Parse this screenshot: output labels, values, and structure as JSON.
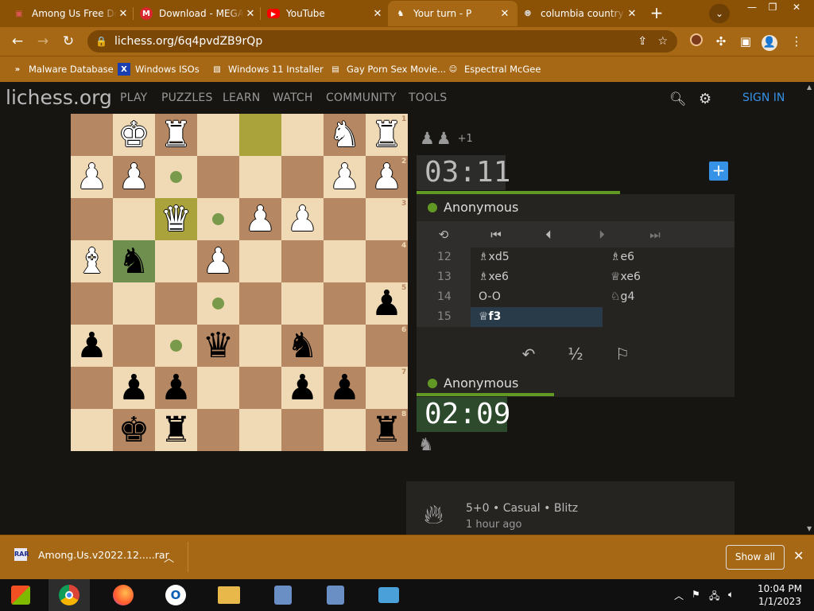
{
  "browser": {
    "tabs": [
      {
        "title": "Among Us Free Do",
        "icon": "app-icon",
        "active": false
      },
      {
        "title": "Download - MEGA",
        "icon": "mega-icon",
        "active": false
      },
      {
        "title": "YouTube",
        "icon": "youtube-icon",
        "active": false
      },
      {
        "title": "Your turn - P",
        "icon": "lichess-icon",
        "active": true
      },
      {
        "title": "columbia country",
        "icon": "globe-icon",
        "active": false
      }
    ],
    "new_tab": "+",
    "url": "lichess.org/6q4pvdZB9rQp",
    "bookmarks": [
      {
        "label": "Malware Database",
        "icon": "chevron-icon"
      },
      {
        "label": "Windows ISOs",
        "icon": "x-icon"
      },
      {
        "label": "Windows 11 Installer",
        "icon": "image-icon"
      },
      {
        "label": "Gay Porn Sex Movie...",
        "icon": "tv-icon"
      },
      {
        "label": "Espectral McGee",
        "icon": "avatar-icon"
      }
    ],
    "theme_color": "#a66815"
  },
  "site": {
    "logo_main": "lichess",
    "logo_tld": ".org",
    "nav": [
      "PLAY",
      "PUZZLES",
      "LEARN",
      "WATCH",
      "COMMUNITY",
      "TOOLS"
    ],
    "sign_in": "SIGN IN"
  },
  "board": {
    "orientation": "black",
    "files_bottom": [
      "h",
      "g",
      "f",
      "e",
      "d",
      "c",
      "b",
      "a"
    ],
    "ranks_right": [
      "1",
      "2",
      "3",
      "4",
      "5",
      "6",
      "7",
      "8"
    ],
    "pieces": [
      {
        "sq": "g1",
        "color": "w",
        "piece": "king"
      },
      {
        "sq": "f1",
        "color": "w",
        "piece": "rook"
      },
      {
        "sq": "b1",
        "color": "w",
        "piece": "knight"
      },
      {
        "sq": "a1",
        "color": "w",
        "piece": "rook"
      },
      {
        "sq": "h2",
        "color": "w",
        "piece": "pawn"
      },
      {
        "sq": "g2",
        "color": "w",
        "piece": "pawn"
      },
      {
        "sq": "b2",
        "color": "w",
        "piece": "pawn"
      },
      {
        "sq": "a2",
        "color": "w",
        "piece": "pawn"
      },
      {
        "sq": "f3",
        "color": "w",
        "piece": "queen"
      },
      {
        "sq": "d3",
        "color": "w",
        "piece": "pawn"
      },
      {
        "sq": "c3",
        "color": "w",
        "piece": "pawn"
      },
      {
        "sq": "h4",
        "color": "w",
        "piece": "bishop"
      },
      {
        "sq": "e4",
        "color": "w",
        "piece": "pawn"
      },
      {
        "sq": "g4",
        "color": "b",
        "piece": "knight"
      },
      {
        "sq": "a5",
        "color": "b",
        "piece": "pawn"
      },
      {
        "sq": "h6",
        "color": "b",
        "piece": "pawn"
      },
      {
        "sq": "e6",
        "color": "b",
        "piece": "queen"
      },
      {
        "sq": "c6",
        "color": "b",
        "piece": "knight"
      },
      {
        "sq": "g7",
        "color": "b",
        "piece": "pawn"
      },
      {
        "sq": "f7",
        "color": "b",
        "piece": "pawn"
      },
      {
        "sq": "c7",
        "color": "b",
        "piece": "pawn"
      },
      {
        "sq": "b7",
        "color": "b",
        "piece": "pawn"
      },
      {
        "sq": "g8",
        "color": "b",
        "piece": "king"
      },
      {
        "sq": "f8",
        "color": "b",
        "piece": "rook"
      },
      {
        "sq": "a8",
        "color": "b",
        "piece": "rook"
      }
    ],
    "last_move": [
      "d1",
      "f3"
    ],
    "selected": "g4",
    "move_dots": [
      "f2",
      "e3",
      "e5",
      "f6"
    ]
  },
  "game": {
    "top_player": {
      "name": "Anonymous",
      "clock": "03:11",
      "material": [
        "pawn",
        "pawn"
      ],
      "material_plus": "+1"
    },
    "bottom_player": {
      "name": "Anonymous",
      "clock": "02:09",
      "material": [
        "knight"
      ]
    },
    "moves": [
      {
        "n": "12",
        "w": "♗xd5",
        "b": "♗e6"
      },
      {
        "n": "13",
        "w": "♗xe6",
        "b": "♕xe6"
      },
      {
        "n": "14",
        "w": "O-O",
        "b": "♘g4"
      },
      {
        "n": "15",
        "w": "♕f3",
        "b": ""
      }
    ],
    "current_move": "15w",
    "draw_symbol": "½",
    "info_line1": "5+0 • Casual • Blitz",
    "info_line2": "1 hour ago"
  },
  "downloads": {
    "file": "Among.Us.v2022.12.....rar",
    "show_all": "Show all"
  },
  "taskbar": {
    "apps": [
      "start-icon",
      "chrome-icon",
      "firefox-icon",
      "edge-icon",
      "explorer-icon",
      "installer-icon",
      "installer-icon",
      "network-icon"
    ],
    "time": "10:04 PM",
    "date": "1/1/2023"
  }
}
